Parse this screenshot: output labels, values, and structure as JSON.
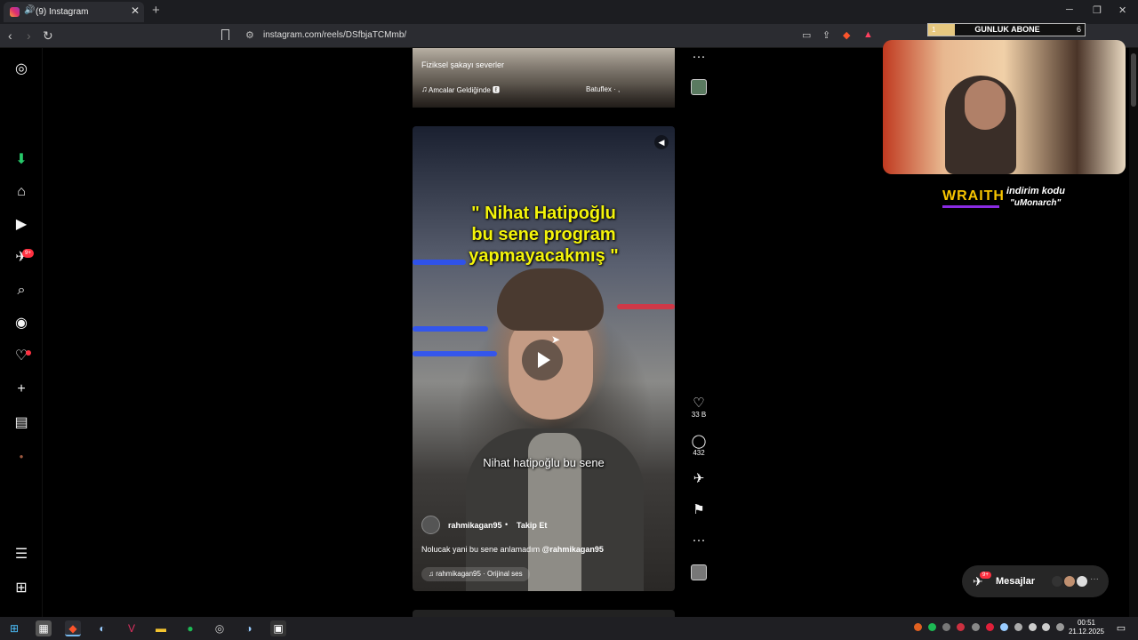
{
  "browser": {
    "tab_title": "(9) Instagram",
    "tab_close": "✕",
    "new_tab": "+",
    "url": "instagram.com/reels/DSfbjaTCMmb/",
    "window": {
      "minimize": "─",
      "restore": "❐",
      "close": "✕"
    }
  },
  "sidebar": {
    "badge_notifications": "9+"
  },
  "previous_reel": {
    "caption": "Fiziksel şakayı severler",
    "music": "Amcalar Geldiğinde 🅴",
    "right_text": "Batuflex · ,"
  },
  "reel": {
    "title_lines": [
      "\" Nihat Hatipoğlu",
      "bu sene program",
      "yapmayacakmış \""
    ],
    "subtitle": "Nihat hatipoğlu bu sene",
    "username": "rahmikagan95",
    "separator": "•",
    "follow_label": "Takip Et",
    "caption_text": "Nolucak yani bu sene anlamadım ",
    "caption_mention": "@rahmikagan95",
    "audio": "rahmikagan95 · Orijinal ses"
  },
  "actions": {
    "likes": "33 B",
    "comments": "432",
    "more": "···"
  },
  "overlay": {
    "sub_goal_left": "1",
    "sub_goal_title": "GUNLUK ABONE",
    "sub_goal_right": "6",
    "sub_goal_progress": 0.17,
    "sponsor_brand": "WRAITH",
    "sponsor_line1": "indirim kodu",
    "sponsor_line2": "\"uMonarch\""
  },
  "messages": {
    "label": "Mesajlar",
    "badge": "9+"
  },
  "taskbar": {
    "time": "00:51",
    "date": "21.12.2025"
  },
  "colors": {
    "accent_red": "#ff3040",
    "title_yellow": "#f4f40a",
    "sponsor_yellow": "#f7c400"
  }
}
